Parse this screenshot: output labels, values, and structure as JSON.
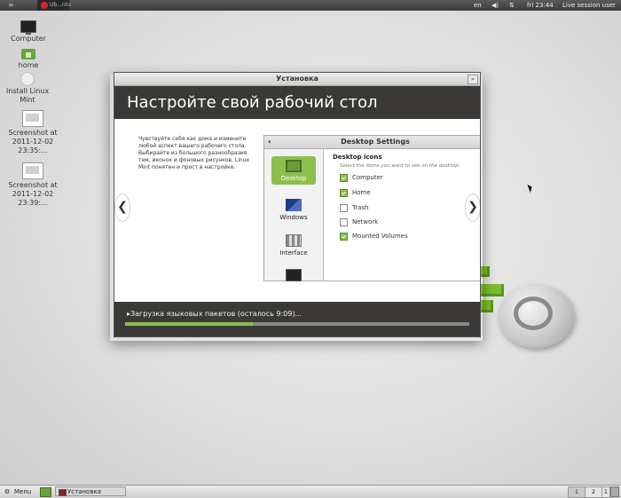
{
  "top_panel": {
    "loop_glyph": "∞",
    "app_label": "Ub...ntu",
    "lang": "en",
    "volume_glyph": "◀)",
    "network_glyph": "⇅",
    "clock": "fri 23:44",
    "session": "Live session user"
  },
  "desktop_icons": [
    {
      "label": "Computer"
    },
    {
      "label": "home"
    },
    {
      "label": "Install Linux Mint"
    },
    {
      "label": "Screenshot at 2011-12-02 23:35:..."
    },
    {
      "label": "Screenshot at 2011-12-02 23:39:..."
    }
  ],
  "installer": {
    "window_title": "Установка",
    "minimize_label": "–",
    "header": "Настройте свой рабочий стол",
    "description": "Чувствуйте себя как дома и измените любой аспект вашего рабочего стола. Выбирайте из большого разнообразия тем, иконок и фоновых рисунков. Linux Mint понятен и прост в настройке.",
    "prev_label": "❮",
    "next_label": "❯",
    "status_text": "▸Загрузка языковых пакетов (осталось 9:09)...",
    "progress": 0.37
  },
  "desktop_settings": {
    "title": "Desktop Settings",
    "collapse_glyph": "▾",
    "sidebar": [
      {
        "label": "Desktop",
        "active": true
      },
      {
        "label": "Windows",
        "active": false
      },
      {
        "label": "Interface",
        "active": false
      },
      {
        "label": "",
        "active": false
      }
    ],
    "section_title": "Desktop icons",
    "section_hint": "Select the items you want to see on the desktop:",
    "items": [
      {
        "label": "Computer",
        "checked": true
      },
      {
        "label": "Home",
        "checked": true
      },
      {
        "label": "Trash",
        "checked": false
      },
      {
        "label": "Network",
        "checked": false
      },
      {
        "label": "Mounted Volumes",
        "checked": true
      }
    ]
  },
  "bottom_panel": {
    "menu_label": "Menu",
    "menu_glyph": "⚙",
    "task_label": "Установка",
    "workspaces": [
      "1",
      "2",
      "1"
    ]
  },
  "colors": {
    "accent_green": "#8cbf4f",
    "dark_header": "#3b3936"
  }
}
